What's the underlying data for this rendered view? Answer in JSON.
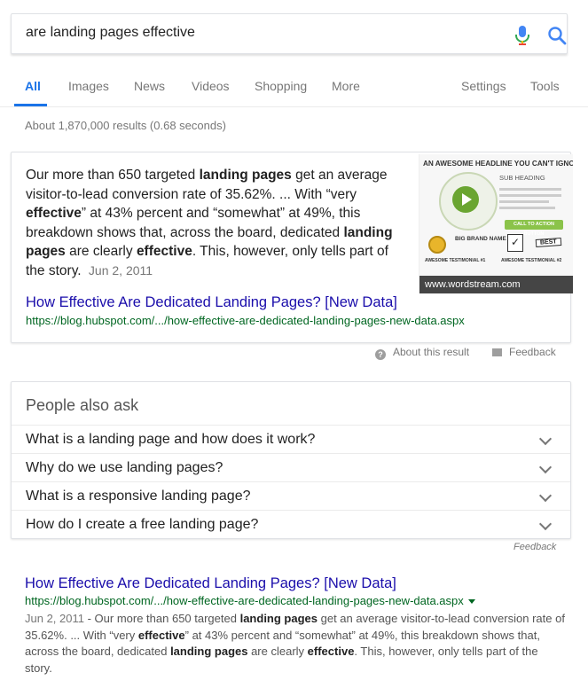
{
  "search": {
    "query": "are landing pages effective"
  },
  "tabs": [
    {
      "label": "All",
      "active": true
    },
    {
      "label": "Images"
    },
    {
      "label": "News"
    },
    {
      "label": "Videos"
    },
    {
      "label": "Shopping"
    },
    {
      "label": "More"
    },
    {
      "label": "Settings"
    },
    {
      "label": "Tools"
    }
  ],
  "stats": "About 1,870,000 results (0.68 seconds)",
  "snippet": {
    "text_parts": [
      {
        "t": "Our more than 650 targeted ",
        "b": false
      },
      {
        "t": "landing pages",
        "b": true
      },
      {
        "t": " get an average visitor-to-lead conversion rate of 35.62%. ... With “very ",
        "b": false
      },
      {
        "t": "effective",
        "b": true
      },
      {
        "t": "” at 43% percent and “somewhat” at 49%, this breakdown shows that, across the board, dedicated ",
        "b": false
      },
      {
        "t": "landing pages",
        "b": true
      },
      {
        "t": " are clearly ",
        "b": false
      },
      {
        "t": "effective",
        "b": true
      },
      {
        "t": ". This, however, only tells part of the story.",
        "b": false
      }
    ],
    "date": "Jun 2, 2011",
    "thumbnail": {
      "headline": "AN AWESOME HEADLINE YOU CAN'T IGNORE",
      "sub_heading": "SUB HEADING",
      "cta": "CALL TO ACTION BUTTON",
      "brand": "BIG BRAND NAME",
      "best": "BEST",
      "testimonial_1": "AWESOME TESTIMONIAL #1",
      "testimonial_2": "AWESOME TESTIMONIAL #2",
      "caption": "www.wordstream.com"
    },
    "link_title": "How Effective Are Dedicated Landing Pages? [New Data]",
    "url": "https://blog.hubspot.com/.../how-effective-are-dedicated-landing-pages-new-data.aspx"
  },
  "about_result": "About this result",
  "feedback": "Feedback",
  "paa": {
    "title": "People also ask",
    "questions": [
      "What is a landing page and how does it work?",
      "Why do we use landing pages?",
      "What is a responsive landing page?",
      "How do I create a free landing page?"
    ],
    "feedback": "Feedback"
  },
  "result": {
    "title": "How Effective Are Dedicated Landing Pages? [New Data]",
    "url": "https://blog.hubspot.com/.../how-effective-are-dedicated-landing-pages-new-data.aspx",
    "date": "Jun 2, 2011",
    "snippet_parts": [
      {
        "t": " - Our more than 650 targeted ",
        "b": false
      },
      {
        "t": "landing pages",
        "b": true
      },
      {
        "t": " get an average visitor-to-lead conversion rate of 35.62%. ... With “very ",
        "b": false
      },
      {
        "t": "effective",
        "b": true
      },
      {
        "t": "” at 43% percent and “somewhat” at 49%, this breakdown shows that, across the board, dedicated ",
        "b": false
      },
      {
        "t": "landing pages",
        "b": true
      },
      {
        "t": " are clearly ",
        "b": false
      },
      {
        "t": "effective",
        "b": true
      },
      {
        "t": ". This, however, only tells part of the story.",
        "b": false
      }
    ]
  },
  "colors": {
    "accent": "#1a73e8",
    "link": "#1a0dab",
    "url": "#006621"
  },
  "icons": [
    "microphone-icon",
    "search-icon",
    "help-icon",
    "feedback-icon",
    "chevron-down-icon"
  ]
}
